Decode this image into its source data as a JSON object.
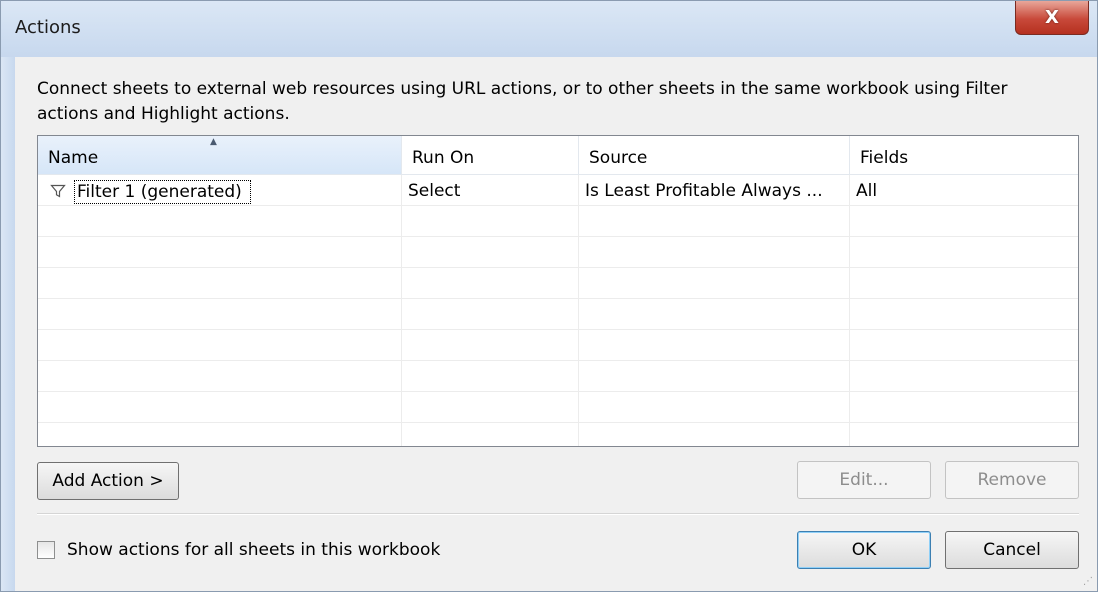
{
  "window": {
    "title": "Actions",
    "close_label": "X"
  },
  "description": "Connect sheets to external web resources using URL actions, or to other sheets in the same workbook using Filter actions and Highlight actions.",
  "table": {
    "columns": [
      "Name",
      "Run On",
      "Source",
      "Fields"
    ],
    "sorted_column": "Name",
    "rows": [
      {
        "icon": "filter-icon",
        "name": "Filter 1 (generated)",
        "run_on": "Select",
        "source": "Is Least Profitable Always ...",
        "fields": "All"
      }
    ]
  },
  "buttons": {
    "add_action": "Add Action >",
    "edit": "Edit...",
    "remove": "Remove",
    "ok": "OK",
    "cancel": "Cancel"
  },
  "checkbox": {
    "label": "Show actions for all sheets in this workbook",
    "checked": false
  },
  "grip_glyph": "⋰"
}
